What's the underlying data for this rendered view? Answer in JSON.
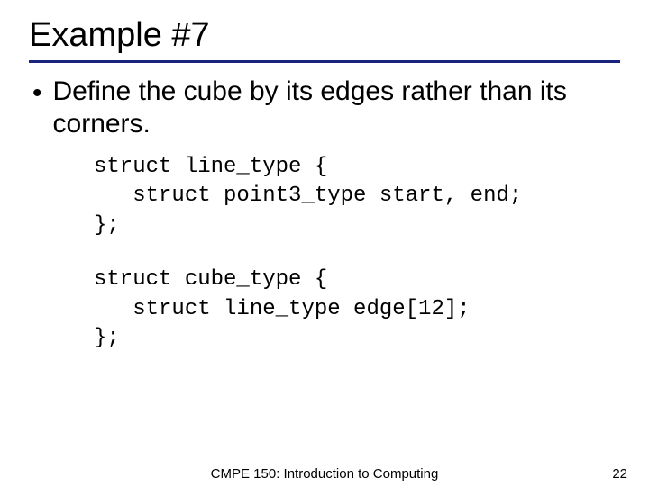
{
  "title": "Example #7",
  "bullet": {
    "marker": "•",
    "text": "Define the cube by its edges rather than its corners."
  },
  "code": {
    "block1_l1": "struct line_type {",
    "block1_l2": "   struct point3_type start, end;",
    "block1_l3": "};",
    "block2_l1": "struct cube_type {",
    "block2_l2": "   struct line_type edge[12];",
    "block2_l3": "};"
  },
  "footer": {
    "course": "CMPE 150: Introduction to Computing",
    "page": "22"
  }
}
